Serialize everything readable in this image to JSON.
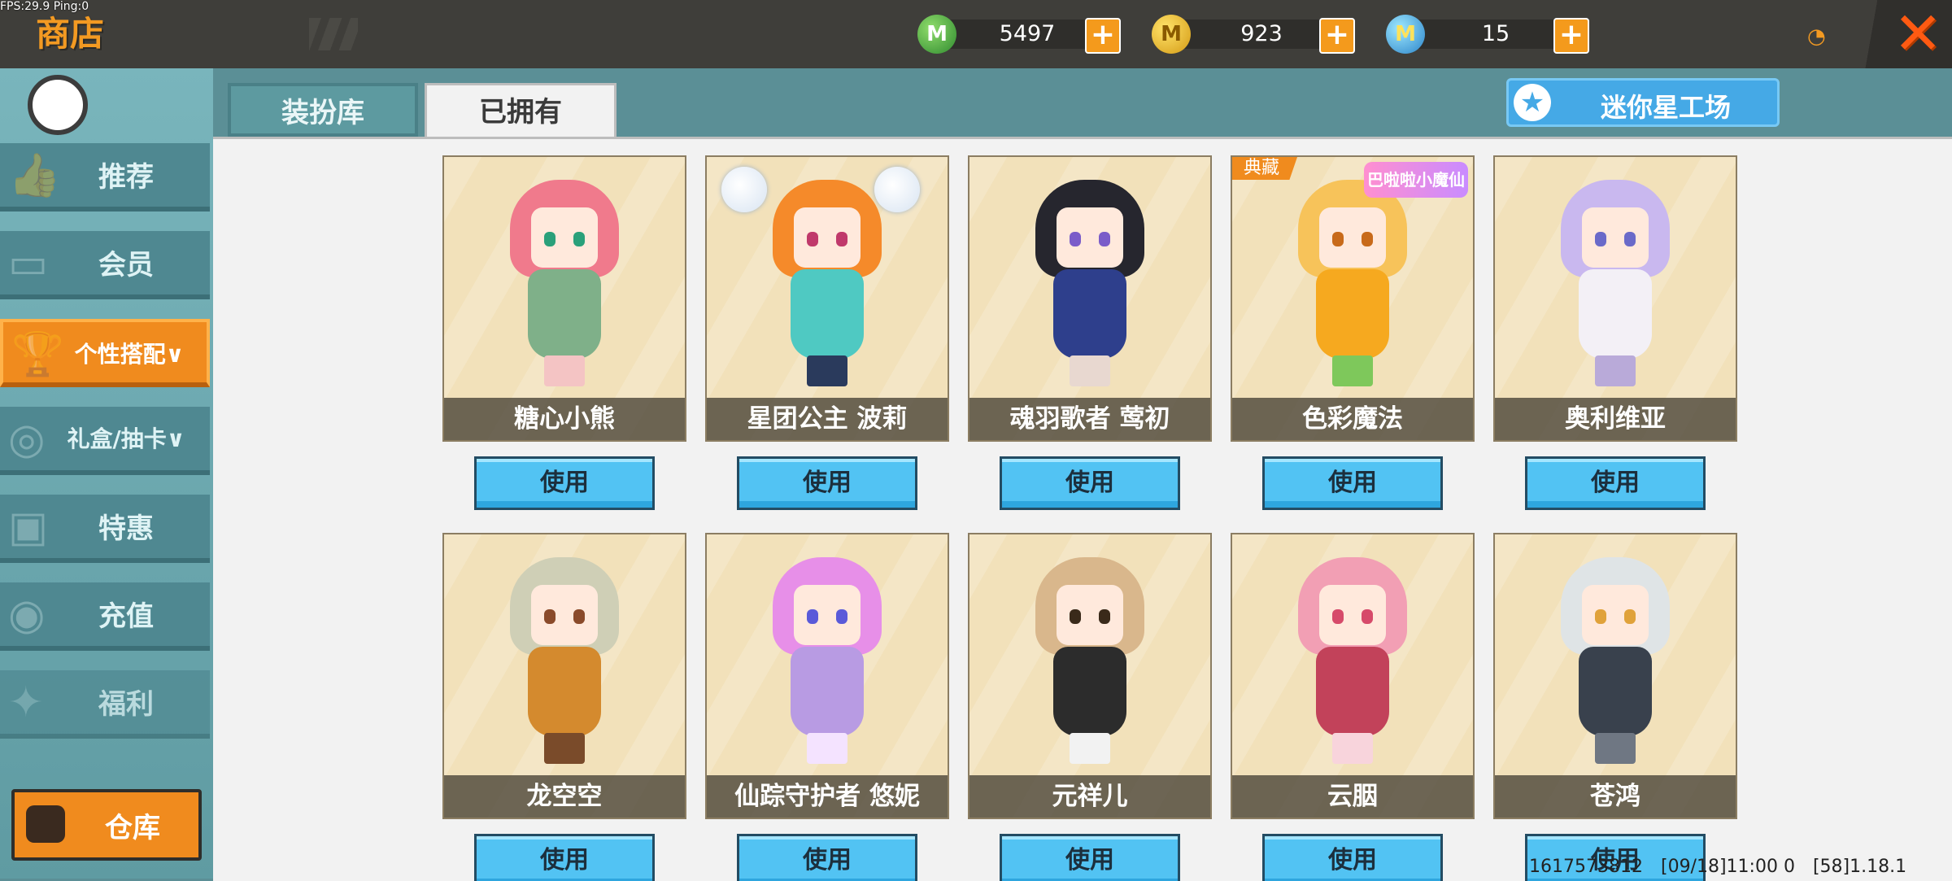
{
  "status": {
    "fps_label": "FPS:29.9  Ping:0"
  },
  "header": {
    "title": "商店",
    "currencies": [
      {
        "name": "green-gem",
        "symbol": "M",
        "value": "5497",
        "color": "#4caf50"
      },
      {
        "name": "gold-coin",
        "symbol": "M",
        "value": "923",
        "color": "#f2c230"
      },
      {
        "name": "blue-coin",
        "symbol": "M",
        "value": "15",
        "color": "#3aa0e0"
      }
    ],
    "plus_symbol": "+",
    "close_symbol": "✕",
    "signal_symbol": "◔"
  },
  "sidebar": {
    "items": [
      {
        "label": "推荐",
        "icon": "thumbs-up-icon",
        "glyph": "👍"
      },
      {
        "label": "会员",
        "icon": "member-card-icon",
        "glyph": "▭"
      },
      {
        "label": "个性搭配",
        "icon": "trophy-icon",
        "glyph": "🏆",
        "active": true,
        "caret": "∨"
      },
      {
        "label": "礼盒/抽卡",
        "icon": "gift-disc-icon",
        "glyph": "◎",
        "caret": "∨"
      },
      {
        "label": "特惠",
        "icon": "gift-box-icon",
        "glyph": "▣"
      },
      {
        "label": "充值",
        "icon": "coin-stack-icon",
        "glyph": "◉"
      },
      {
        "label": "福利",
        "icon": "welfare-icon",
        "glyph": "✦"
      }
    ],
    "warehouse_label": "仓库"
  },
  "tabs": [
    {
      "label": "装扮库",
      "active": false
    },
    {
      "label": "已拥有",
      "active": true
    }
  ],
  "workshop": {
    "label": "迷你星工场",
    "icon": "star-icon",
    "glyph": "★"
  },
  "use_label": "使用",
  "skins": [
    {
      "name": "糖心小熊",
      "hair": "#f07a8c",
      "body": "#7fb089",
      "legs": "#f4c4c4",
      "eye": "#2aa07a"
    },
    {
      "name": "星团公主 波莉",
      "hair": "#f58a2a",
      "body": "#4fc9c2",
      "legs": "#2a3a5c",
      "eye": "#c0396b"
    },
    {
      "name": "魂羽歌者 莺初",
      "hair": "#26262e",
      "body": "#2e3f8c",
      "legs": "#e8d8d0",
      "eye": "#7a5cc9"
    },
    {
      "name": "色彩魔法",
      "hair": "#f7c35a",
      "body": "#f6a91f",
      "legs": "#7ec85b",
      "eye": "#c86a1a",
      "badge": "典藏",
      "logo": "巴啦啦小魔仙"
    },
    {
      "name": "奥利维亚",
      "hair": "#c9b8ef",
      "body": "#f3f0f6",
      "legs": "#b9aad9",
      "eye": "#6a6ac9"
    },
    {
      "name": "龙空空",
      "hair": "#cfcfb6",
      "body": "#d48a2e",
      "legs": "#7a4b2a",
      "eye": "#8a4a2a"
    },
    {
      "name": "仙踪守护者 悠妮",
      "hair": "#e78fe8",
      "body": "#b89be3",
      "legs": "#f4e3ff",
      "eye": "#5a5ad9"
    },
    {
      "name": "元祥儿",
      "hair": "#d9b78c",
      "body": "#2c2c2c",
      "legs": "#f2f2f2",
      "eye": "#3a2a1a"
    },
    {
      "name": "云胭",
      "hair": "#f29fb4",
      "body": "#c2425a",
      "legs": "#f8d4dc",
      "eye": "#d64a6a"
    },
    {
      "name": "苍鸿",
      "hair": "#dfe4e6",
      "body": "#39414d",
      "legs": "#6f7783",
      "eye": "#e0a23a"
    }
  ],
  "footer": {
    "uid": "1617573812",
    "time": "[09/18]11:00 0",
    "version": "[58]1.18.1"
  }
}
